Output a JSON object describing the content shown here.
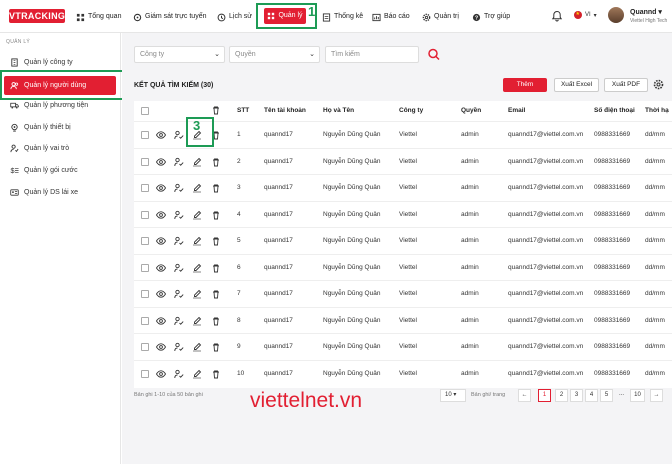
{
  "topbar": {
    "logo": "VTRACKING",
    "nav": [
      {
        "label": "Tổng quan",
        "icon": "dashboard-icon"
      },
      {
        "label": "Giám sát trực tuyến",
        "icon": "target-icon"
      },
      {
        "label": "Lịch sử",
        "icon": "history-icon"
      },
      {
        "label": "Quản lý",
        "icon": "grid-icon"
      },
      {
        "label": "Thống kê",
        "icon": "stats-icon"
      },
      {
        "label": "Báo cáo",
        "icon": "report-icon"
      },
      {
        "label": "Quản trị",
        "icon": "gear-icon"
      },
      {
        "label": "Trợ giúp",
        "icon": "help-icon"
      }
    ],
    "lang": "VI",
    "user_name": "Quannd",
    "user_role": "Viettel High Tech"
  },
  "sidebar": {
    "title": "QUẢN LÝ",
    "items": [
      {
        "label": "Quản lý công ty",
        "icon": "building-icon"
      },
      {
        "label": "Quản lý người dùng",
        "icon": "users-icon"
      },
      {
        "label": "Quản lý phương tiện",
        "icon": "truck-icon"
      },
      {
        "label": "Quản lý thiết bị",
        "icon": "device-icon"
      },
      {
        "label": "Quản lý vai trò",
        "icon": "role-icon"
      },
      {
        "label": "Quản lý gói cước",
        "icon": "package-icon"
      },
      {
        "label": "Quản lý DS lái xe",
        "icon": "driver-icon"
      }
    ]
  },
  "filters": {
    "company_placeholder": "Công ty",
    "role_placeholder": "Quyền",
    "search_placeholder": "Tìm kiếm"
  },
  "results": {
    "title": "KẾT QUẢ TÌM KIẾM (30)",
    "add_label": "Thêm",
    "excel_label": "Xuất Excel",
    "pdf_label": "Xuất PDF"
  },
  "table": {
    "headers": [
      "STT",
      "Tên tài khoản",
      "Họ và Tên",
      "Công ty",
      "Quyền",
      "Email",
      "Số điện thoại",
      "Thời hạ"
    ],
    "rows": [
      [
        "1",
        "quannd17",
        "Nguyễn Dũng Quân",
        "Viettel",
        "admin",
        "quannd17@viettel.com.vn",
        "0988331669",
        "dd/mm"
      ],
      [
        "2",
        "quannd17",
        "Nguyễn Dũng Quân",
        "Viettel",
        "admin",
        "quannd17@viettel.com.vn",
        "0988331669",
        "dd/mm"
      ],
      [
        "3",
        "quannd17",
        "Nguyễn Dũng Quân",
        "Viettel",
        "admin",
        "quannd17@viettel.com.vn",
        "0988331669",
        "dd/mm"
      ],
      [
        "4",
        "quannd17",
        "Nguyễn Dũng Quân",
        "Viettel",
        "admin",
        "quannd17@viettel.com.vn",
        "0988331669",
        "dd/mm"
      ],
      [
        "5",
        "quannd17",
        "Nguyễn Dũng Quân",
        "Viettel",
        "admin",
        "quannd17@viettel.com.vn",
        "0988331669",
        "dd/mm"
      ],
      [
        "6",
        "quannd17",
        "Nguyễn Dũng Quân",
        "Viettel",
        "admin",
        "quannd17@viettel.com.vn",
        "0988331669",
        "dd/mm"
      ],
      [
        "7",
        "quannd17",
        "Nguyễn Dũng Quân",
        "Viettel",
        "admin",
        "quannd17@viettel.com.vn",
        "0988331669",
        "dd/mm"
      ],
      [
        "8",
        "quannd17",
        "Nguyễn Dũng Quân",
        "Viettel",
        "admin",
        "quannd17@viettel.com.vn",
        "0988331669",
        "dd/mm"
      ],
      [
        "9",
        "quannd17",
        "Nguyễn Dũng Quân",
        "Viettel",
        "admin",
        "quannd17@viettel.com.vn",
        "0988331669",
        "dd/mm"
      ],
      [
        "10",
        "quannd17",
        "Nguyễn Dũng Quân",
        "Viettel",
        "admin",
        "quannd17@viettel.com.vn",
        "0988331669",
        "dd/mm"
      ]
    ]
  },
  "footer": {
    "record_info": "Bản ghi 1-10 của 50 bản ghi",
    "page_size": "10",
    "page_size_label": "Bản ghi/ trang",
    "pages": [
      "1",
      "2",
      "3",
      "4",
      "5",
      "...",
      "10"
    ],
    "current_page": "1"
  },
  "annotations": {
    "n1": "1",
    "n2": "2",
    "n3": "3"
  },
  "watermark": "viettelnet.vn",
  "colors": {
    "brand": "#e21f32",
    "annotation": "#1d9b55"
  }
}
